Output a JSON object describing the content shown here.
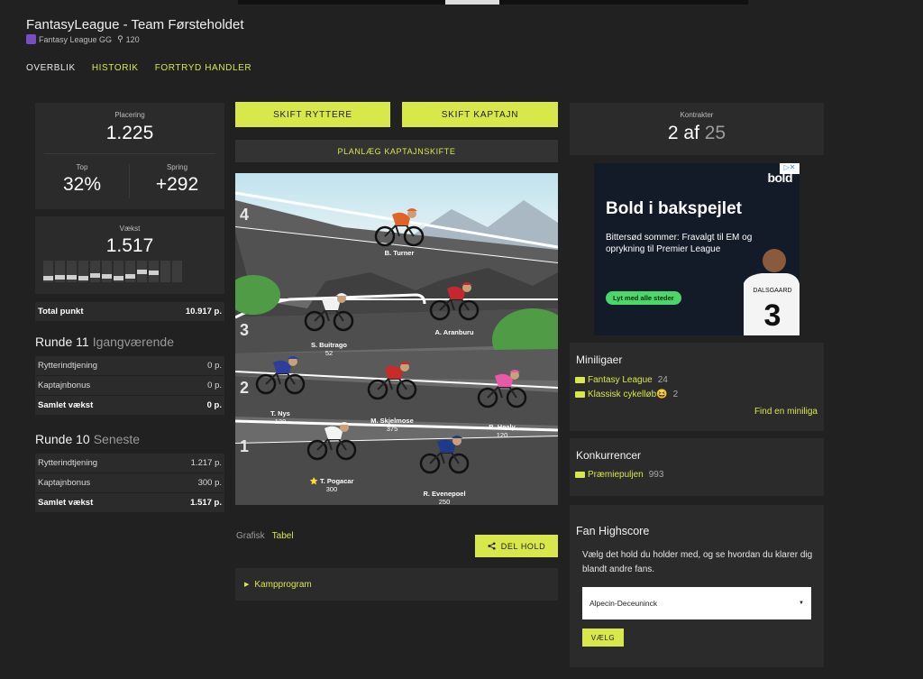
{
  "header": {
    "title": "FantasyLeague - Team Førsteholdet",
    "league_name": "Fantasy League GG",
    "league_members": "120"
  },
  "nav": {
    "items": [
      "OVERBLIK",
      "HISTORIK",
      "FORTRYD HANDLER"
    ]
  },
  "stats": {
    "placering_label": "Placering",
    "placering": "1.225",
    "top_label": "Top",
    "top": "32%",
    "spring_label": "Spring",
    "spring": "+292",
    "vaekst_label": "Vækst",
    "vaekst": "1.517",
    "growth_bars": [
      0.2,
      0.25,
      0.25,
      0.2,
      0.35,
      0.3,
      0.2,
      0.3,
      0.5,
      0.45,
      0,
      0
    ]
  },
  "total": {
    "label": "Total punkt",
    "value": "10.917 p."
  },
  "round11": {
    "title": "Runde 11",
    "status": "Igangværende",
    "rows": [
      {
        "label": "Rytterindtjening",
        "value": "0 p."
      },
      {
        "label": "Kaptajnbonus",
        "value": "0 p."
      },
      {
        "label": "Samlet vækst",
        "value": "0 p."
      }
    ]
  },
  "round10": {
    "title": "Runde 10",
    "status": "Seneste",
    "rows": [
      {
        "label": "Rytterindtjening",
        "value": "1.217 p."
      },
      {
        "label": "Kaptajnbonus",
        "value": "300 p."
      },
      {
        "label": "Samlet vækst",
        "value": "1.517 p."
      }
    ]
  },
  "actions": {
    "skift_ryttere": "SKIFT RYTTERE",
    "skift_kaptajn": "SKIFT KAPTAJN",
    "plan": "PLANLÆG KAPTAJNSKIFTE",
    "share": "DEL HOLD"
  },
  "team": {
    "rows": [
      "4",
      "3",
      "2",
      "1"
    ],
    "riders": [
      {
        "name": "B. Turner",
        "price": "",
        "jersey": "#e0642a",
        "row": 4
      },
      {
        "name": "S. Buitrago",
        "price": "52",
        "jersey": "#f2f2f2",
        "row": 3
      },
      {
        "name": "A. Aranburu",
        "price": "",
        "jersey": "#c2282d",
        "row": 3
      },
      {
        "name": "T. Nys",
        "price": "120",
        "jersey": "#2d3f9a",
        "row": 2
      },
      {
        "name": "M. Skjelmose",
        "price": "375",
        "jersey": "#c92a2a",
        "row": 2
      },
      {
        "name": "B. Healy",
        "price": "120",
        "jersey": "#e85aa8",
        "row": 2
      },
      {
        "name": "T. Pogacar",
        "price": "300",
        "jersey": "#f3f3f3",
        "row": 1,
        "captain": true
      },
      {
        "name": "R. Evenepoel",
        "price": "250",
        "jersey": "#1e3a88",
        "row": 1
      }
    ]
  },
  "view_tabs": [
    "Grafisk",
    "Tabel"
  ],
  "kampprogram": "Kampprogram",
  "kontrakter": {
    "label": "Kontrakter",
    "value": "2 af",
    "max": "25"
  },
  "ad": {
    "brand": "bold",
    "headline": "Bold i bakspejlet",
    "text": "Bittersød sommer: Fravalgt til EM og oprykning til Premier League",
    "cta": "Lyt med alle steder",
    "shirt_name": "DALSGAARD",
    "shirt_number": "3"
  },
  "miniligaer": {
    "title": "Miniligaer",
    "items": [
      {
        "name": "Fantasy League",
        "count": "24"
      },
      {
        "name": "Klassisk cykelløb😆",
        "count": "2"
      }
    ],
    "find": "Find en miniliga"
  },
  "konkurrencer": {
    "title": "Konkurrencer",
    "items": [
      {
        "name": "Præmiepuljen",
        "count": "993"
      }
    ]
  },
  "fan": {
    "title": "Fan Highscore",
    "desc": "Vælg det hold du holder med, og se hvordan du klarer dig blandt andre fans.",
    "selected": "Alpecin-Deceuninck",
    "button": "VÆLG"
  }
}
